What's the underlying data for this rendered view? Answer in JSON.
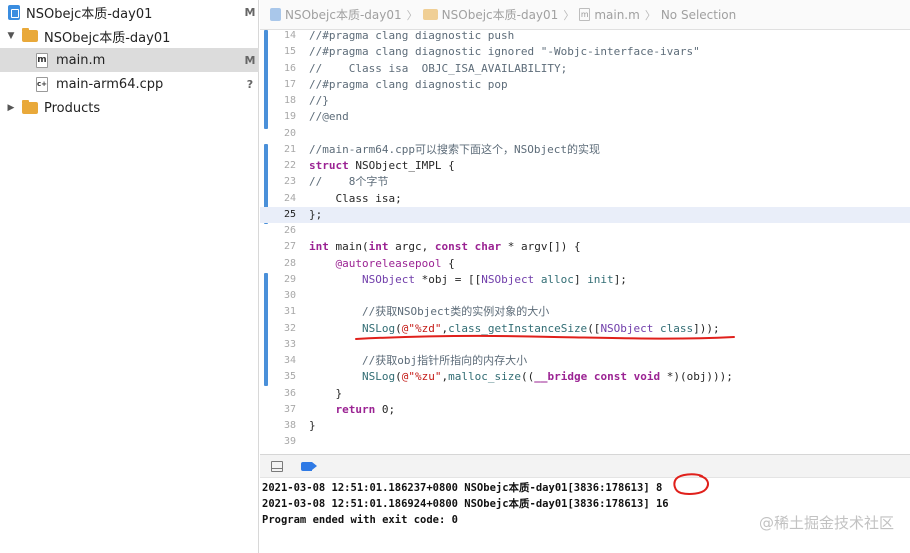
{
  "navigator": {
    "items": [
      {
        "label": "NSObejc本质-day01",
        "badge": "M",
        "icon": "project-icon"
      },
      {
        "label": "NSObejc本质-day01",
        "badge": "",
        "icon": "folder-icon",
        "disclosure": "▼"
      },
      {
        "label": "main.m",
        "badge": "M",
        "icon": "m-file-icon",
        "glyph": "m"
      },
      {
        "label": "main-arm64.cpp",
        "badge": "?",
        "icon": "cpp-file-icon",
        "glyph": "c+"
      },
      {
        "label": "Products",
        "badge": "",
        "icon": "folder-icon",
        "disclosure": "▶"
      }
    ]
  },
  "jumpbar": {
    "project": "NSObejc本质-day01",
    "group": "NSObejc本质-day01",
    "file": "main.m",
    "file_glyph": "m",
    "selection": "No Selection",
    "separator": "〉"
  },
  "editor": {
    "current_line": "25",
    "lines": [
      {
        "n": "14",
        "tokens": [
          {
            "t": "cmt",
            "v": "//#pragma clang diagnostic push"
          }
        ]
      },
      {
        "n": "15",
        "tokens": [
          {
            "t": "cmt",
            "v": "//#pragma clang diagnostic ignored \"-Wobjc-interface-ivars\""
          }
        ]
      },
      {
        "n": "16",
        "tokens": [
          {
            "t": "cmt",
            "v": "//    Class isa  OBJC_ISA_AVAILABILITY;"
          }
        ]
      },
      {
        "n": "17",
        "tokens": [
          {
            "t": "cmt",
            "v": "//#pragma clang diagnostic pop"
          }
        ]
      },
      {
        "n": "18",
        "tokens": [
          {
            "t": "cmt",
            "v": "//}"
          }
        ]
      },
      {
        "n": "19",
        "tokens": [
          {
            "t": "cmt",
            "v": "//@end"
          }
        ]
      },
      {
        "n": "20",
        "tokens": []
      },
      {
        "n": "21",
        "tokens": [
          {
            "t": "cmt",
            "v": "//main-arm64.cpp可以搜索下面这个，NSObject的实现"
          }
        ]
      },
      {
        "n": "22",
        "tokens": [
          {
            "t": "kw",
            "v": "struct"
          },
          {
            "t": "",
            "v": " NSObject_IMPL {"
          }
        ]
      },
      {
        "n": "23",
        "tokens": [
          {
            "t": "cmt",
            "v": "//    8个字节"
          }
        ]
      },
      {
        "n": "24",
        "tokens": [
          {
            "t": "",
            "v": "    Class isa;"
          }
        ]
      },
      {
        "n": "25",
        "tokens": [
          {
            "t": "",
            "v": "};"
          }
        ]
      },
      {
        "n": "26",
        "tokens": []
      },
      {
        "n": "27",
        "tokens": [
          {
            "t": "kw",
            "v": "int"
          },
          {
            "t": "",
            "v": " main("
          },
          {
            "t": "kw",
            "v": "int"
          },
          {
            "t": "",
            "v": " argc, "
          },
          {
            "t": "kw",
            "v": "const"
          },
          {
            "t": "",
            "v": " "
          },
          {
            "t": "kw",
            "v": "char"
          },
          {
            "t": "",
            "v": " * argv[]) {"
          }
        ]
      },
      {
        "n": "28",
        "tokens": [
          {
            "t": "",
            "v": "    "
          },
          {
            "t": "attr",
            "v": "@autoreleasepool"
          },
          {
            "t": "",
            "v": " {"
          }
        ]
      },
      {
        "n": "29",
        "tokens": [
          {
            "t": "",
            "v": "        "
          },
          {
            "t": "cls",
            "v": "NSObject"
          },
          {
            "t": "",
            "v": " *obj = [["
          },
          {
            "t": "cls",
            "v": "NSObject"
          },
          {
            "t": "",
            "v": " "
          },
          {
            "t": "fn",
            "v": "alloc"
          },
          {
            "t": "",
            "v": "] "
          },
          {
            "t": "fn",
            "v": "init"
          },
          {
            "t": "",
            "v": "];"
          }
        ]
      },
      {
        "n": "30",
        "tokens": []
      },
      {
        "n": "31",
        "tokens": [
          {
            "t": "",
            "v": "        "
          },
          {
            "t": "cmt",
            "v": "//获取NSObject类的实例对象的大小"
          }
        ]
      },
      {
        "n": "32",
        "tokens": [
          {
            "t": "",
            "v": "        "
          },
          {
            "t": "fn",
            "v": "NSLog"
          },
          {
            "t": "",
            "v": "("
          },
          {
            "t": "str",
            "v": "@\"%zd\""
          },
          {
            "t": "",
            "v": ","
          },
          {
            "t": "fn",
            "v": "class_getInstanceSize"
          },
          {
            "t": "",
            "v": "(["
          },
          {
            "t": "cls",
            "v": "NSObject"
          },
          {
            "t": "",
            "v": " "
          },
          {
            "t": "fn",
            "v": "class"
          },
          {
            "t": "",
            "v": "]));"
          }
        ]
      },
      {
        "n": "33",
        "tokens": []
      },
      {
        "n": "34",
        "tokens": [
          {
            "t": "",
            "v": "        "
          },
          {
            "t": "cmt",
            "v": "//获取obj指针所指向的内存大小"
          }
        ]
      },
      {
        "n": "35",
        "tokens": [
          {
            "t": "",
            "v": "        "
          },
          {
            "t": "fn",
            "v": "NSLog"
          },
          {
            "t": "",
            "v": "("
          },
          {
            "t": "str",
            "v": "@\"%zu\""
          },
          {
            "t": "",
            "v": ","
          },
          {
            "t": "fn",
            "v": "malloc_size"
          },
          {
            "t": "",
            "v": "(("
          },
          {
            "t": "kw",
            "v": "__bridge"
          },
          {
            "t": "",
            "v": " "
          },
          {
            "t": "kw",
            "v": "const"
          },
          {
            "t": "",
            "v": " "
          },
          {
            "t": "kw",
            "v": "void"
          },
          {
            "t": "",
            "v": " *)(obj)));"
          }
        ]
      },
      {
        "n": "36",
        "tokens": [
          {
            "t": "",
            "v": "    }"
          }
        ]
      },
      {
        "n": "37",
        "tokens": [
          {
            "t": "",
            "v": "    "
          },
          {
            "t": "kw",
            "v": "return"
          },
          {
            "t": "",
            "v": " 0;"
          }
        ]
      },
      {
        "n": "38",
        "tokens": [
          {
            "t": "",
            "v": "}"
          }
        ]
      },
      {
        "n": "39",
        "tokens": []
      }
    ]
  },
  "console": {
    "lines": [
      "2021-03-08 12:51:01.186237+0800 NSObejc本质-day01[3836:178613] 8",
      "2021-03-08 12:51:01.186924+0800 NSObejc本质-day01[3836:178613] 16",
      "Program ended with exit code: 0"
    ]
  },
  "colors": {
    "keyword": "#9b2393",
    "comment": "#5d6c79",
    "string": "#c41a16",
    "change_bar": "#4a90d9",
    "annotation": "#e0201b",
    "selected_row": "#dcdcdc"
  },
  "watermark": "@稀土掘金技术社区"
}
